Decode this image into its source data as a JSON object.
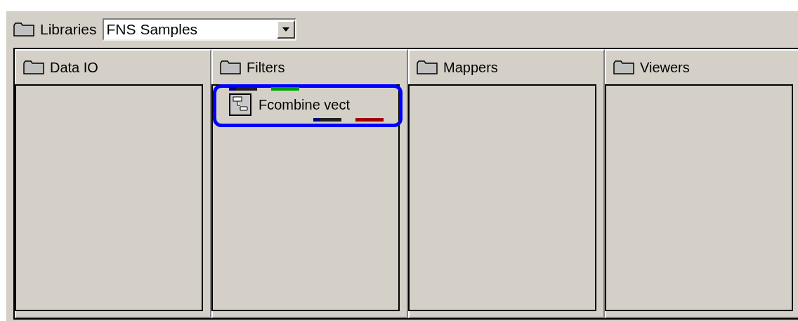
{
  "libraries": {
    "label": "Libraries",
    "value": "FNS Samples"
  },
  "columns": [
    {
      "title": "Data IO"
    },
    {
      "title": "Filters",
      "modules": [
        {
          "name": "Fcombine vect",
          "selected": true,
          "inputs": [
            {
              "kind": "tipped",
              "color": "#000080"
            },
            {
              "kind": "solid",
              "color": "#00a000"
            }
          ],
          "outputs": [
            {
              "kind": "tipped",
              "color": "#000080"
            },
            {
              "kind": "solid",
              "color": "#a00000"
            }
          ]
        }
      ]
    },
    {
      "title": "Mappers"
    },
    {
      "title": "Viewers"
    }
  ]
}
